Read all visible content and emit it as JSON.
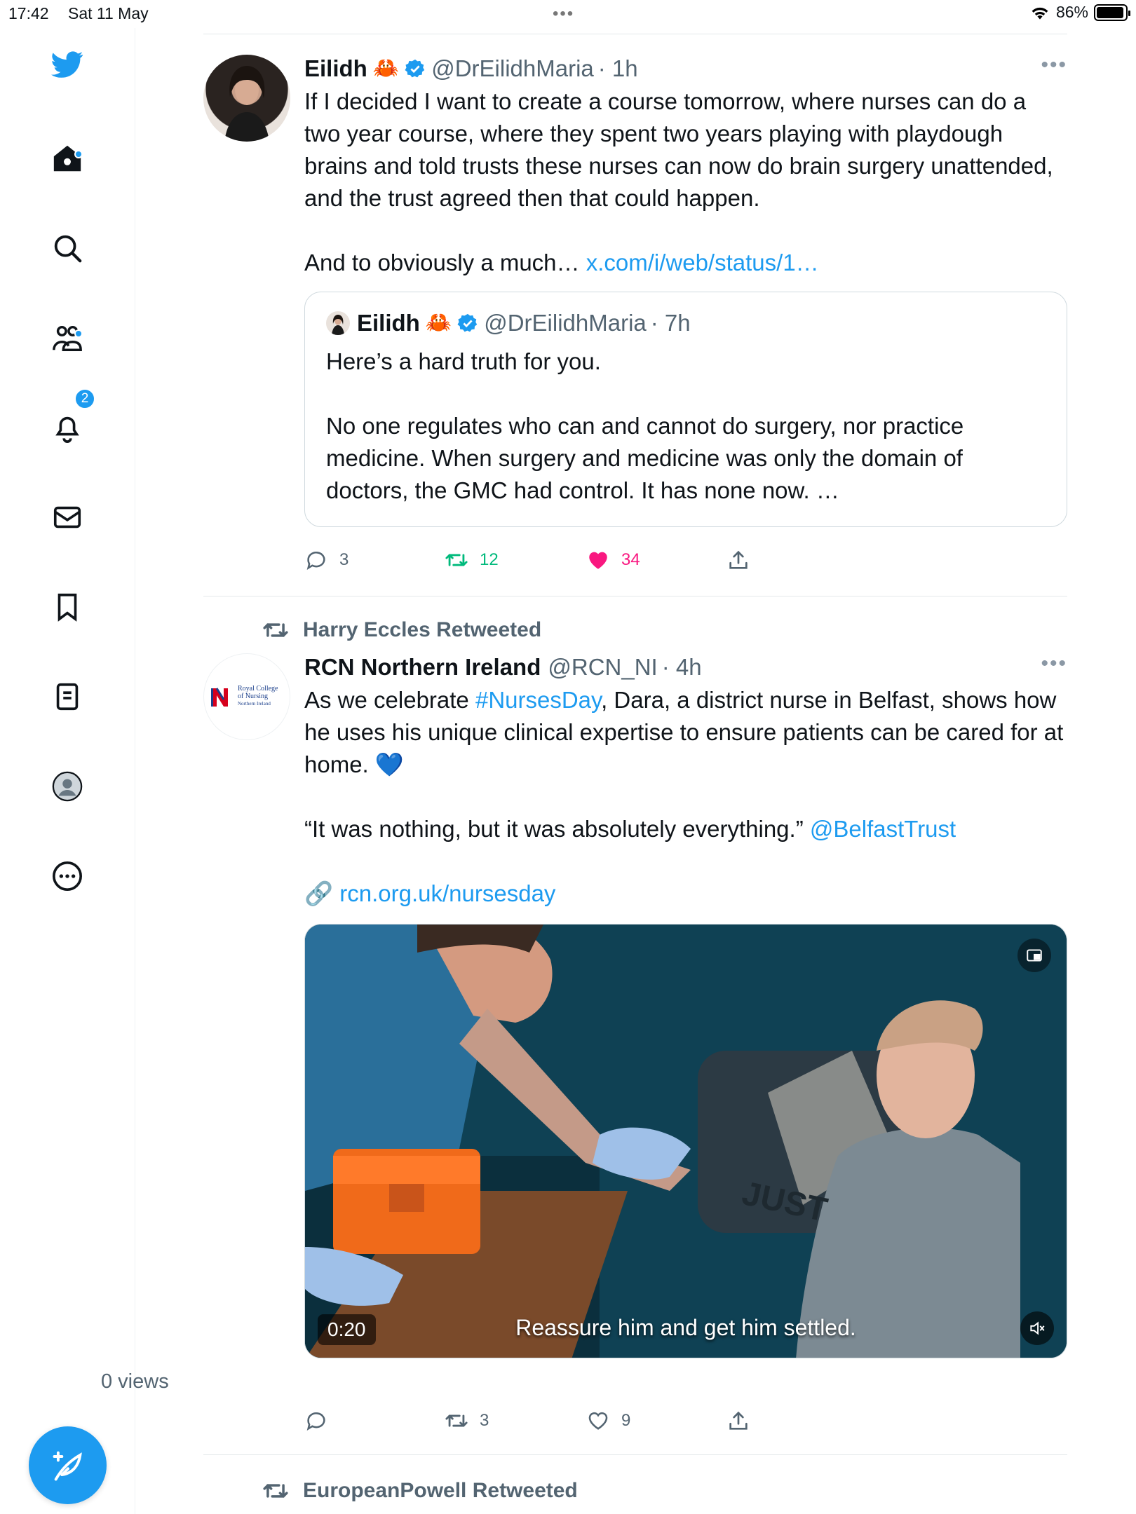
{
  "status_bar": {
    "time": "17:42",
    "date": "Sat 11 May",
    "battery": "86%",
    "battery_level": 0.86
  },
  "nav": {
    "items": [
      "twitter-logo",
      "home",
      "explore",
      "communities",
      "notifications",
      "messages",
      "bookmarks",
      "lists",
      "profile",
      "more"
    ],
    "notifications_badge": "2"
  },
  "tweets": [
    {
      "name": "Eilidh",
      "emoji": "🦀",
      "handle": "@DrEilidhMaria",
      "time": "· 1h",
      "text_part1": "If I decided I want to create a course tomorrow, where nurses can do a two year course, where they spent two years playing with playdough brains and told trusts these nurses can now do brain surgery unattended, and the trust agreed then that could happen.\n\nAnd to obviously a much… ",
      "link": "x.com/i/web/status/1…",
      "quote": {
        "name": "Eilidh",
        "emoji": "🦀",
        "handle": "@DrEilidhMaria",
        "time": "· 7h",
        "text": "Here’s a hard truth for you.\n\nNo one regulates who can and cannot do surgery, nor practice medicine. When surgery and medicine was only the domain of doctors, the GMC had control. It has none now. …"
      },
      "replies": "3",
      "retweets": "12",
      "likes": "34"
    },
    {
      "retweeted_by": "Harry Eccles Retweeted",
      "name": "RCN Northern Ireland",
      "handle": "@RCN_NI",
      "time": "· 4h",
      "avatar_text": [
        "Royal College",
        "of Nursing",
        "Northern Ireland"
      ],
      "text_a": "As we celebrate ",
      "hashtag": "#NursesDay",
      "text_b": ", Dara, a district nurse in Belfast, shows how he uses his unique clinical expertise to ensure patients can be cared for at home. 💙\n\n“It was nothing, but it was absolutely everything.” ",
      "mention": "@BelfastTrust",
      "link_emoji": "🔗",
      "link": "rcn.org.uk/nursesday",
      "video": {
        "duration": "0:20",
        "caption": "Reassure him and get him settled."
      },
      "views": "0 views",
      "replies": "",
      "retweets": "3",
      "likes": "9"
    },
    {
      "retweeted_by": "EuropeanPowell Retweeted"
    }
  ],
  "colors": {
    "accent": "#1d9bf0",
    "retweet_green": "#00ba7c",
    "like_pink": "#f91880",
    "muted": "#536471"
  }
}
